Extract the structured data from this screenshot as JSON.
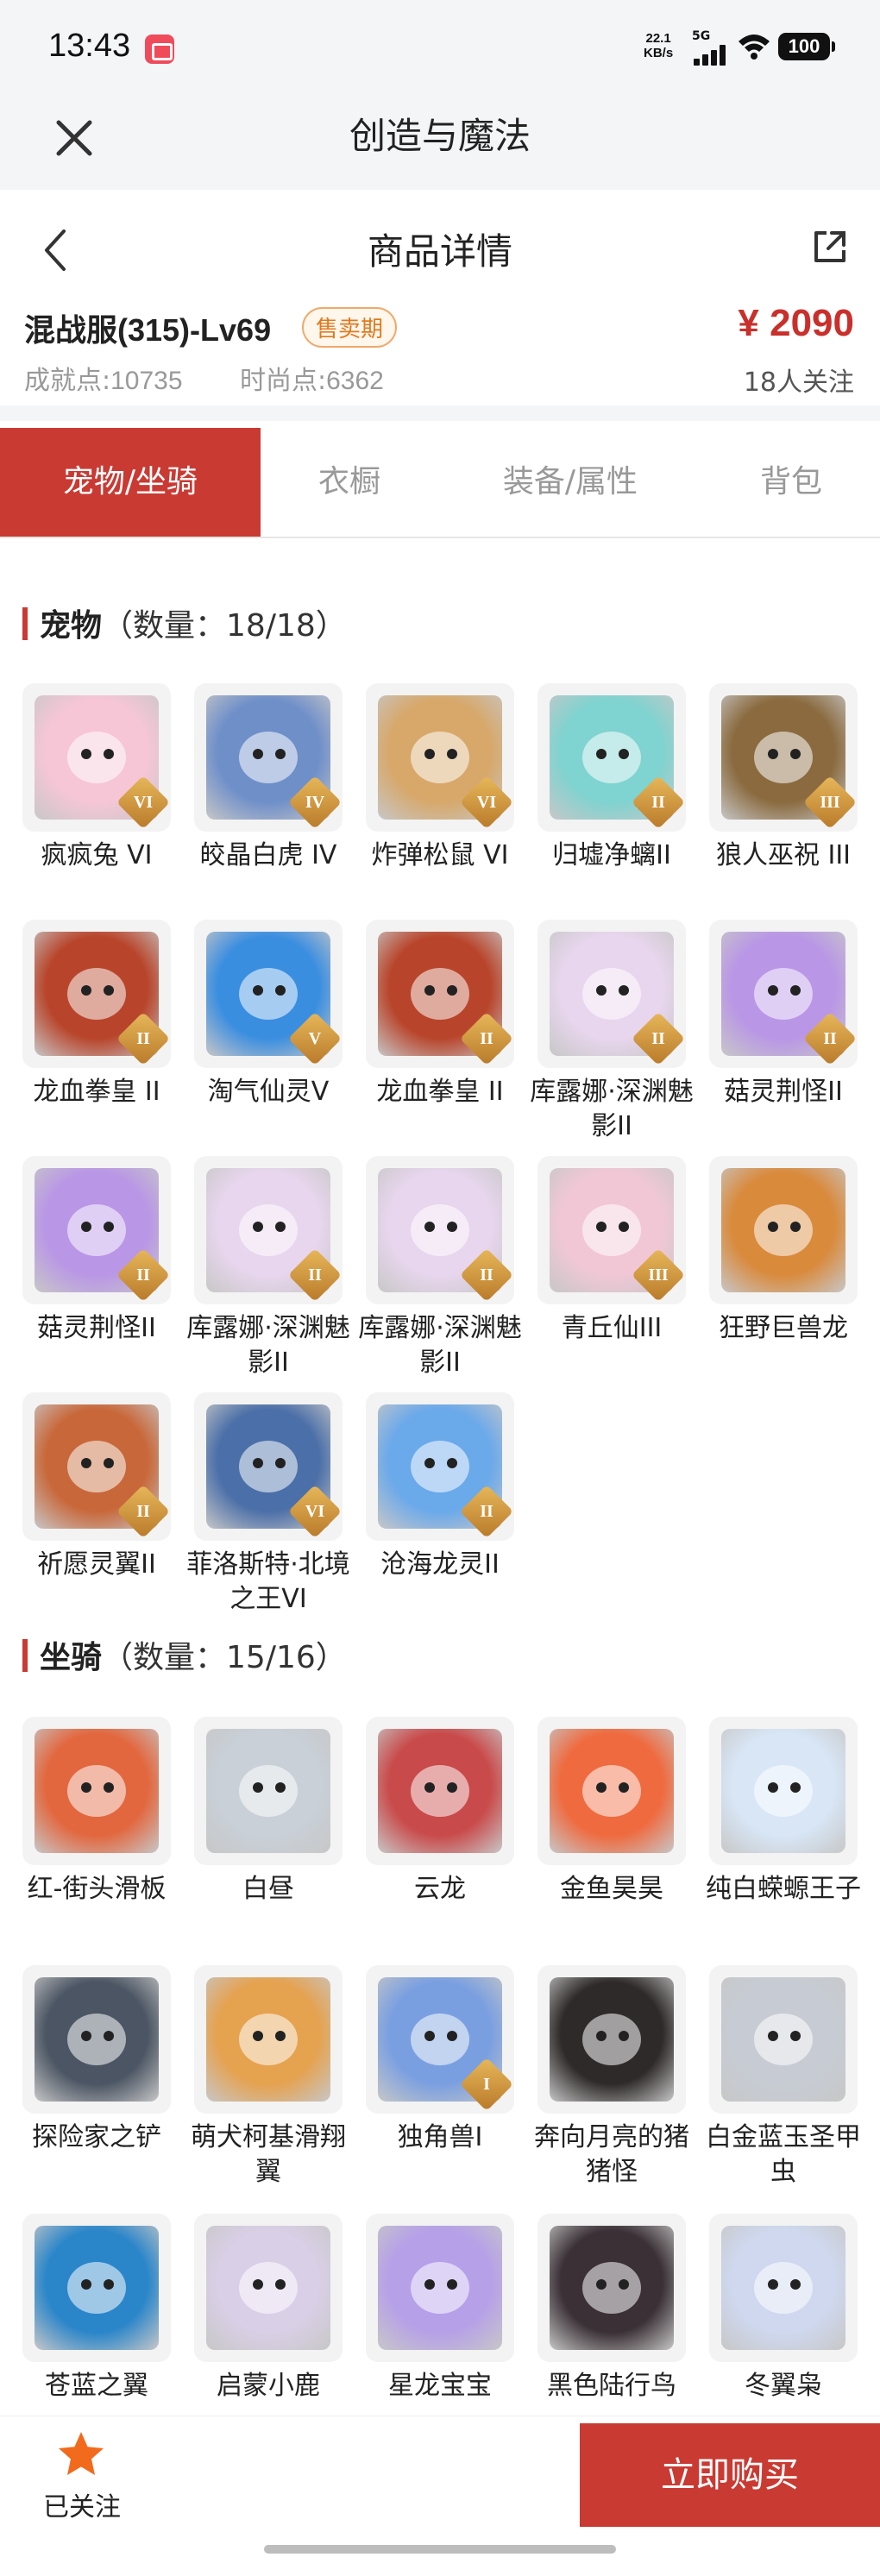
{
  "status_bar": {
    "time": "13:43",
    "net_speed_value": "22.1",
    "net_speed_unit": "KB/s",
    "network": "5G",
    "battery": "100"
  },
  "app": {
    "title": "创造与魔法"
  },
  "detail": {
    "title": "商品详情"
  },
  "summary": {
    "server": "混战服(315)-Lv69",
    "badge": "售卖期",
    "achievement_label": "成就点:",
    "achievement_value": "10735",
    "fashion_label": "时尚点:",
    "fashion_value": "6362",
    "price": "¥ 2090",
    "followers": "18人关注"
  },
  "tabs": [
    "宠物/坐骑",
    "衣橱",
    "装备/属性",
    "背包"
  ],
  "pets": {
    "title": "宠物",
    "count": "（数量：18/18）",
    "items": [
      {
        "name": "疯疯兔 VI",
        "rank": "VI",
        "color": "#f6c6d6"
      },
      {
        "name": "皎晶白虎 IV",
        "rank": "IV",
        "color": "#6f8fc9"
      },
      {
        "name": "炸弹松鼠 VI",
        "rank": "VI",
        "color": "#d7a86a"
      },
      {
        "name": "归墟净螭II",
        "rank": "II",
        "color": "#7fd3d0"
      },
      {
        "name": "狼人巫祝 III",
        "rank": "III",
        "color": "#8a6a3e"
      },
      {
        "name": "龙血拳皇 II",
        "rank": "II",
        "color": "#b8452b"
      },
      {
        "name": "淘气仙灵V",
        "rank": "V",
        "color": "#3a8ee0"
      },
      {
        "name": "龙血拳皇 II",
        "rank": "II",
        "color": "#b8452b"
      },
      {
        "name": "库露娜·深渊魅影II",
        "rank": "II",
        "color": "#e8d6ee"
      },
      {
        "name": "菇灵荆怪II",
        "rank": "II",
        "color": "#b996e6"
      },
      {
        "name": "菇灵荆怪II",
        "rank": "II",
        "color": "#b996e6"
      },
      {
        "name": "库露娜·深渊魅影II",
        "rank": "II",
        "color": "#e8d6ee"
      },
      {
        "name": "库露娜·深渊魅影II",
        "rank": "II",
        "color": "#e8d6ee"
      },
      {
        "name": "青丘仙III",
        "rank": "III",
        "color": "#f1c7d6"
      },
      {
        "name": "狂野巨兽龙",
        "rank": "",
        "color": "#d98a3b"
      },
      {
        "name": "祈愿灵翼II",
        "rank": "II",
        "color": "#c8683a"
      },
      {
        "name": "菲洛斯特·北境之王VI",
        "rank": "VI",
        "color": "#4b6fa8"
      },
      {
        "name": "沧海龙灵II",
        "rank": "II",
        "color": "#6aa9ea"
      }
    ]
  },
  "mounts": {
    "title": "坐骑",
    "count": "（数量：15/16）",
    "items": [
      {
        "name": "红-街头滑板",
        "rank": "",
        "color": "#e2673e"
      },
      {
        "name": "白昼",
        "rank": "",
        "color": "#c9d0d8"
      },
      {
        "name": "云龙",
        "rank": "",
        "color": "#c94a4a"
      },
      {
        "name": "金鱼昊昊",
        "rank": "",
        "color": "#ef6a3e"
      },
      {
        "name": "纯白蝾螈王子",
        "rank": "",
        "color": "#d8e6f6"
      },
      {
        "name": "探险家之铲",
        "rank": "",
        "color": "#4b5563"
      },
      {
        "name": "萌犬柯基滑翔翼",
        "rank": "",
        "color": "#e5a24f"
      },
      {
        "name": "独角兽I",
        "rank": "I",
        "color": "#7a9fe0"
      },
      {
        "name": "奔向月亮的猪猪怪",
        "rank": "",
        "color": "#2f2a2a"
      },
      {
        "name": "白金蓝玉圣甲虫",
        "rank": "",
        "color": "#c7ccd4"
      },
      {
        "name": "苍蓝之翼",
        "rank": "",
        "color": "#2a86c9"
      },
      {
        "name": "启蒙小鹿",
        "rank": "",
        "color": "#d9cfe6"
      },
      {
        "name": "星龙宝宝",
        "rank": "",
        "color": "#b6a0e8"
      },
      {
        "name": "黑色陆行鸟",
        "rank": "",
        "color": "#3a3035"
      },
      {
        "name": "冬翼枭",
        "rank": "",
        "color": "#cfd8ef"
      }
    ]
  },
  "bottom": {
    "fav_label": "已关注",
    "buy_label": "立即购买"
  },
  "icons": {
    "close": "close-icon",
    "back": "back-icon",
    "share": "share-icon",
    "star": "star-icon"
  },
  "colors": {
    "accent": "#c93a33",
    "price": "#c9302c",
    "badge": "#e07a1e",
    "star": "#f26a1b"
  }
}
